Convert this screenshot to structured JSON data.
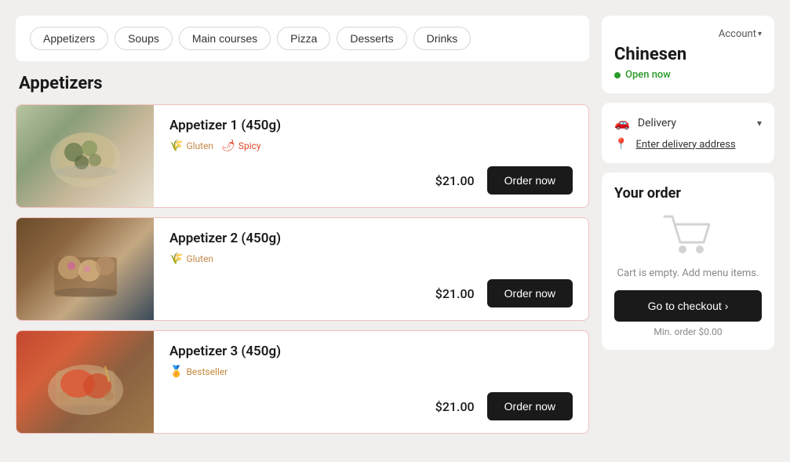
{
  "nav": {
    "categories": [
      "Appetizers",
      "Soups",
      "Main courses",
      "Pizza",
      "Desserts",
      "Drinks"
    ]
  },
  "section": {
    "title": "Appetizers"
  },
  "menu_items": [
    {
      "id": 1,
      "name": "Appetizer 1 (450g)",
      "tags": [
        {
          "label": "Gluten",
          "type": "gluten"
        },
        {
          "label": "Spicy",
          "type": "spicy"
        }
      ],
      "price": "$21.00",
      "order_label": "Order now",
      "img_class": "food-img-1"
    },
    {
      "id": 2,
      "name": "Appetizer 2 (450g)",
      "tags": [
        {
          "label": "Gluten",
          "type": "gluten"
        }
      ],
      "price": "$21.00",
      "order_label": "Order now",
      "img_class": "food-img-2"
    },
    {
      "id": 3,
      "name": "Appetizer 3 (450g)",
      "tags": [
        {
          "label": "Bestseller",
          "type": "bestseller"
        }
      ],
      "price": "$21.00",
      "order_label": "Order now",
      "img_class": "food-img-3"
    }
  ],
  "sidebar": {
    "account_label": "Account",
    "restaurant_name": "Chinesen",
    "open_status": "Open now",
    "delivery_label": "Delivery",
    "address_label": "Enter delivery address",
    "your_order_title": "Your order",
    "cart_empty_text": "Cart is empty. Add menu items.",
    "checkout_label": "Go to checkout ›",
    "min_order_label": "Min. order $0.00"
  }
}
